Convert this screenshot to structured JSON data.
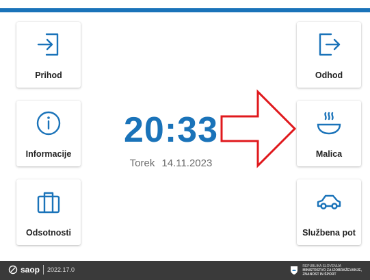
{
  "tiles": {
    "arrival": {
      "label": "Prihod",
      "icon": "login-icon"
    },
    "info": {
      "label": "Informacije",
      "icon": "info-icon"
    },
    "absences": {
      "label": "Odsotnosti",
      "icon": "briefcase-icon"
    },
    "departure": {
      "label": "Odhod",
      "icon": "logout-icon"
    },
    "lunch": {
      "label": "Malica",
      "icon": "soup-bowl-icon"
    },
    "business_trip": {
      "label": "Službena pot",
      "icon": "car-icon"
    }
  },
  "clock": {
    "time": "20:33",
    "day": "Torek",
    "date": "14.11.2023"
  },
  "footer": {
    "brand": "saop",
    "version": "2022.17.0",
    "ministry_lines": [
      "REPUBLIKA SLOVENIJA",
      "MINISTRSTVO ZA IZOBRAŽEVANJE,",
      "ZNANOST IN ŠPORT"
    ]
  },
  "colors": {
    "accent": "#1a73b9",
    "annotation_arrow": "#e0191d",
    "footer_bg": "#3a3a3a"
  }
}
